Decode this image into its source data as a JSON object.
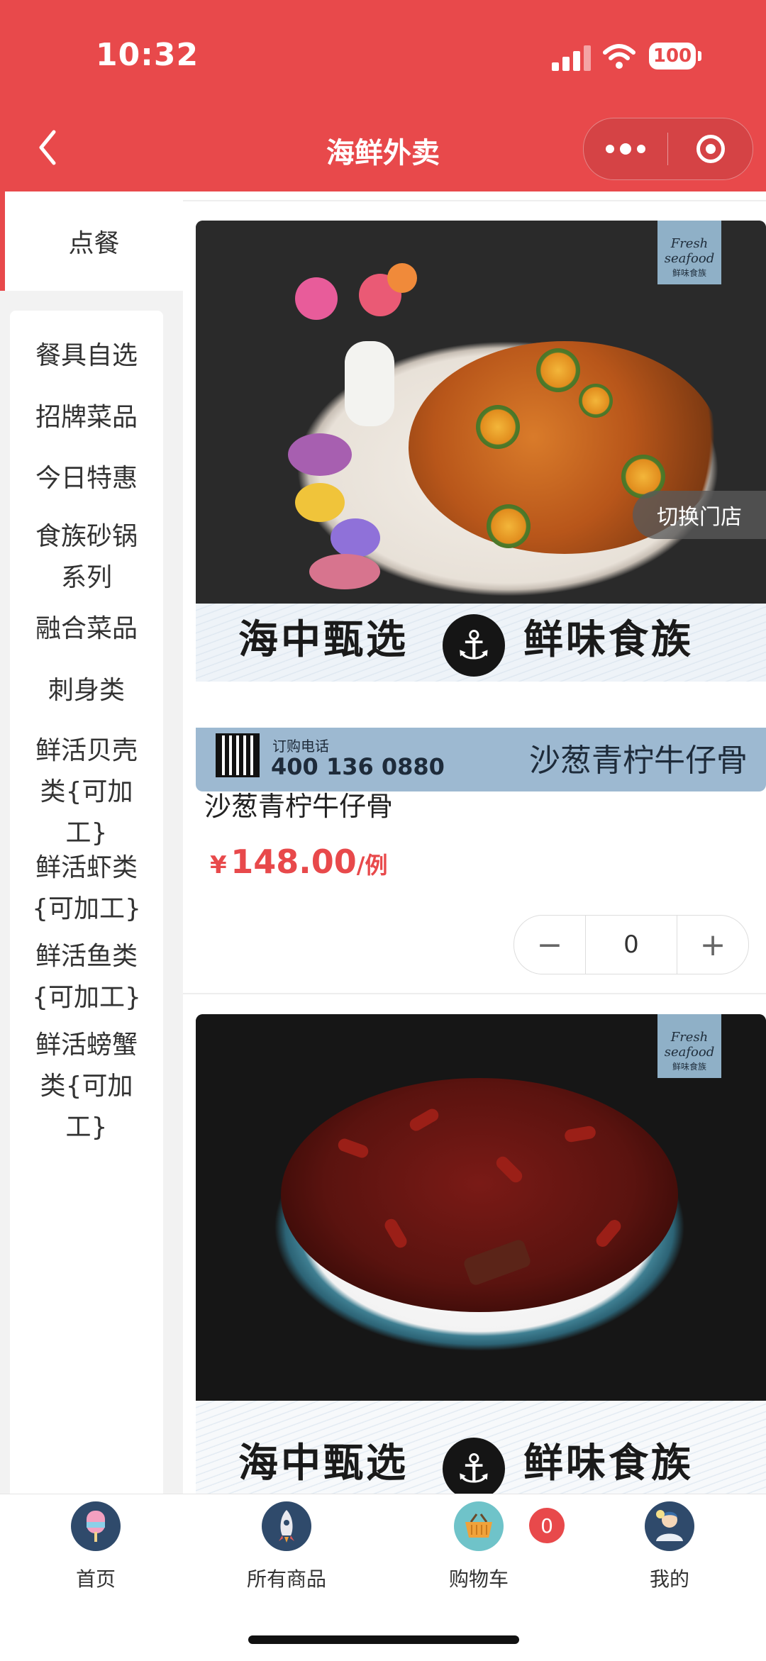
{
  "status_bar": {
    "time": "10:32",
    "battery": "100"
  },
  "nav": {
    "title": "海鲜外卖"
  },
  "sidebar": {
    "active": "点餐",
    "items": [
      "餐具自选",
      "招牌菜品",
      "今日特惠",
      "食族砂锅系列",
      "融合菜品",
      "刺身类",
      "鲜活贝壳类{可加工}",
      "鲜活虾类{可加工}",
      "鲜活鱼类{可加工}",
      "鲜活螃蟹类{可加工}"
    ]
  },
  "switch_store": "切换门店",
  "products": [
    {
      "name": "沙葱青柠牛仔骨",
      "currency": "¥",
      "price": "148.00",
      "unit": "/例",
      "quantity": "0",
      "banner_left": "海中甄选",
      "banner_right": "鲜味食族",
      "order_label": "订购电话",
      "order_phone": "400 136 0880",
      "image_caption": "沙葱青柠牛仔骨",
      "badge_logo": "Fresh seafood",
      "badge_sub": "鲜味食族"
    },
    {
      "banner_left": "海中甄选",
      "banner_right": "鲜味食族",
      "badge_logo": "Fresh seafood",
      "badge_sub": "鲜味食族"
    }
  ],
  "tabbar": {
    "items": [
      "首页",
      "所有商品",
      "购物车",
      "我的"
    ],
    "cart_count": "0"
  },
  "colors": {
    "accent": "#e8494b",
    "info_bar": "#9db9d1"
  }
}
